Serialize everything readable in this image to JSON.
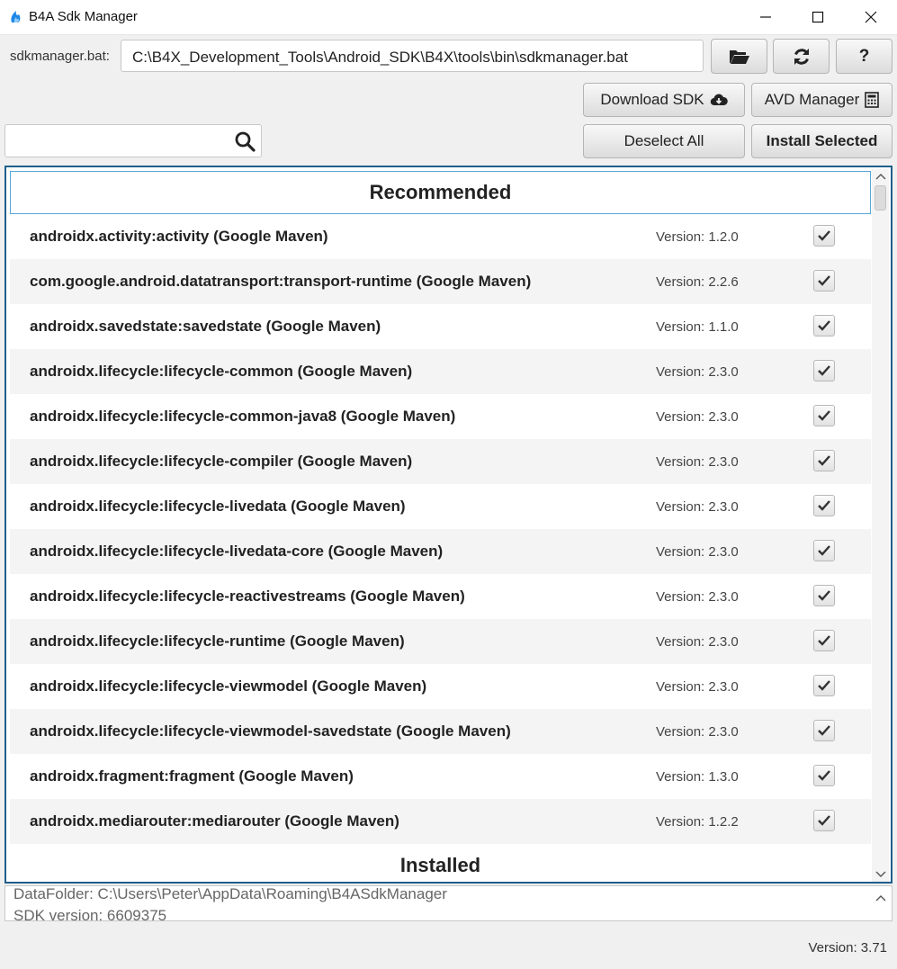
{
  "window": {
    "title": "B4A Sdk Manager"
  },
  "path": {
    "label": "sdkmanager.bat:",
    "value": "C:\\B4X_Development_Tools\\Android_SDK\\B4X\\tools\\bin\\sdkmanager.bat"
  },
  "toolbar": {
    "help_label": "?",
    "download_sdk_label": "Download SDK",
    "avd_manager_label": "AVD Manager",
    "deselect_all_label": "Deselect All",
    "install_selected_label": "Install Selected"
  },
  "search": {
    "value": ""
  },
  "sections": {
    "recommended": "Recommended",
    "installed": "Installed"
  },
  "packages": [
    {
      "name": "androidx.activity:activity (Google Maven)",
      "version": "Version: 1.2.0",
      "checked": true
    },
    {
      "name": "com.google.android.datatransport:transport-runtime (Google Maven)",
      "version": "Version: 2.2.6",
      "checked": true
    },
    {
      "name": "androidx.savedstate:savedstate (Google Maven)",
      "version": "Version: 1.1.0",
      "checked": true
    },
    {
      "name": "androidx.lifecycle:lifecycle-common (Google Maven)",
      "version": "Version: 2.3.0",
      "checked": true
    },
    {
      "name": "androidx.lifecycle:lifecycle-common-java8 (Google Maven)",
      "version": "Version: 2.3.0",
      "checked": true
    },
    {
      "name": "androidx.lifecycle:lifecycle-compiler (Google Maven)",
      "version": "Version: 2.3.0",
      "checked": true
    },
    {
      "name": "androidx.lifecycle:lifecycle-livedata (Google Maven)",
      "version": "Version: 2.3.0",
      "checked": true
    },
    {
      "name": "androidx.lifecycle:lifecycle-livedata-core (Google Maven)",
      "version": "Version: 2.3.0",
      "checked": true
    },
    {
      "name": "androidx.lifecycle:lifecycle-reactivestreams (Google Maven)",
      "version": "Version: 2.3.0",
      "checked": true
    },
    {
      "name": "androidx.lifecycle:lifecycle-runtime (Google Maven)",
      "version": "Version: 2.3.0",
      "checked": true
    },
    {
      "name": "androidx.lifecycle:lifecycle-viewmodel (Google Maven)",
      "version": "Version: 2.3.0",
      "checked": true
    },
    {
      "name": "androidx.lifecycle:lifecycle-viewmodel-savedstate (Google Maven)",
      "version": "Version: 2.3.0",
      "checked": true
    },
    {
      "name": "androidx.fragment:fragment (Google Maven)",
      "version": "Version: 1.3.0",
      "checked": true
    },
    {
      "name": "androidx.mediarouter:mediarouter (Google Maven)",
      "version": "Version: 1.2.2",
      "checked": true
    }
  ],
  "log": {
    "line1": "DataFolder: C:\\Users\\Peter\\AppData\\Roaming\\B4ASdkManager",
    "line2": "SDK version: 6609375"
  },
  "status": {
    "version": "Version: 3.71"
  },
  "colors": {
    "panel_border": "#1f5f8b",
    "header_border": "#58a7d9",
    "icon_blue": "#1e88e5"
  }
}
